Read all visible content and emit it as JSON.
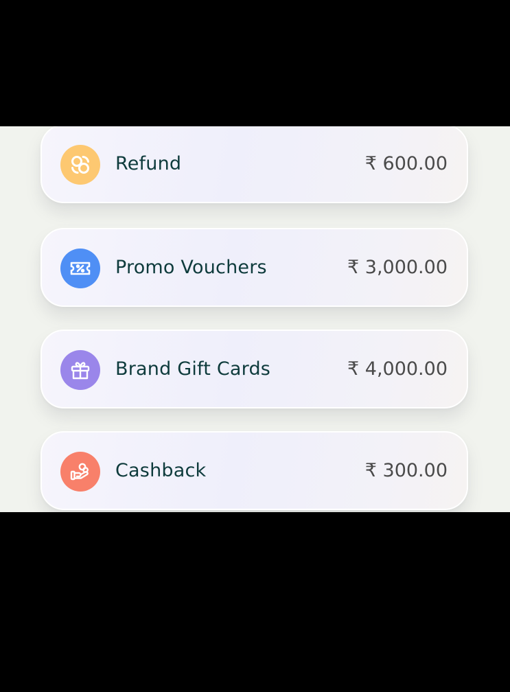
{
  "currency_symbol": "₹",
  "items": [
    {
      "label": "Refund",
      "amount": "₹ 600.00",
      "icon": "refund-icon",
      "icon_bg": "#fdc871"
    },
    {
      "label": "Promo Vouchers",
      "amount": "₹ 3,000.00",
      "icon": "voucher-icon",
      "icon_bg": "#4f8ff5"
    },
    {
      "label": "Brand Gift Cards",
      "amount": "₹ 4,000.00",
      "icon": "gift-icon",
      "icon_bg": "#9a86ea"
    },
    {
      "label": "Cashback",
      "amount": "₹ 300.00",
      "icon": "cashback-hand-icon",
      "icon_bg": "#f8806a"
    }
  ]
}
